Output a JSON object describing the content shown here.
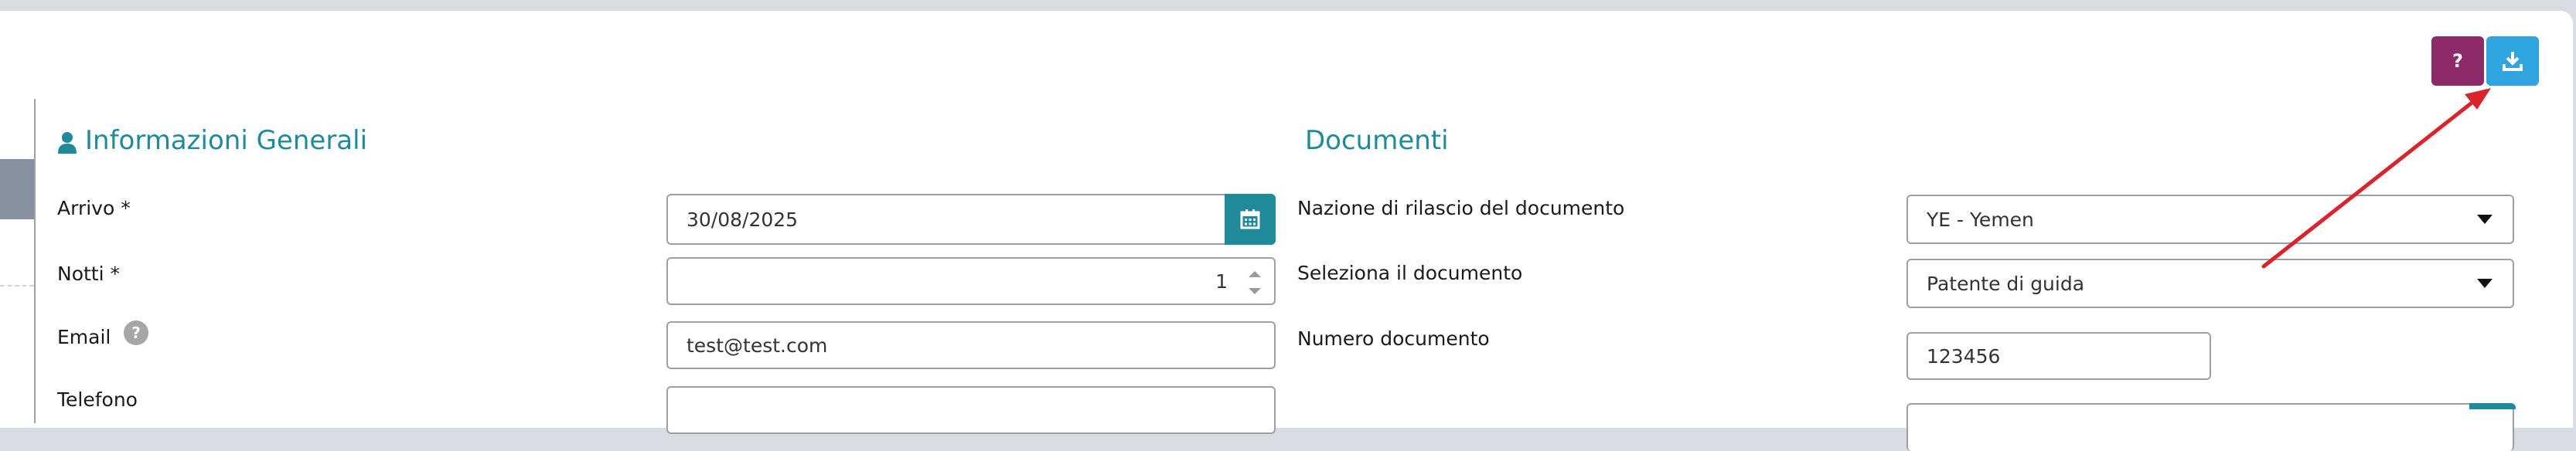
{
  "toolbar": {
    "help_label": "?",
    "export_icon": "download-icon",
    "help_color": "#8e2a6a",
    "export_color": "#2fa4df"
  },
  "general": {
    "title": "Informazioni Generali",
    "title_icon": "user-icon",
    "arrivo_label": "Arrivo *",
    "arrivo_value": "30/08/2025",
    "notti_label": "Notti *",
    "notti_value": "1",
    "email_label": "Email",
    "email_value": "test@test.com",
    "telefono_label": "Telefono",
    "telefono_value": ""
  },
  "documents": {
    "title": "Documenti",
    "nazione_label": "Nazione di rilascio del documento",
    "nazione_value": "YE - Yemen",
    "documento_label": "Seleziona il documento",
    "documento_value": "Patente di guida",
    "numero_label": "Numero documento",
    "numero_value": "123456"
  },
  "colors": {
    "accent": "#1f8a9a",
    "annotation_arrow": "#d9232d"
  }
}
